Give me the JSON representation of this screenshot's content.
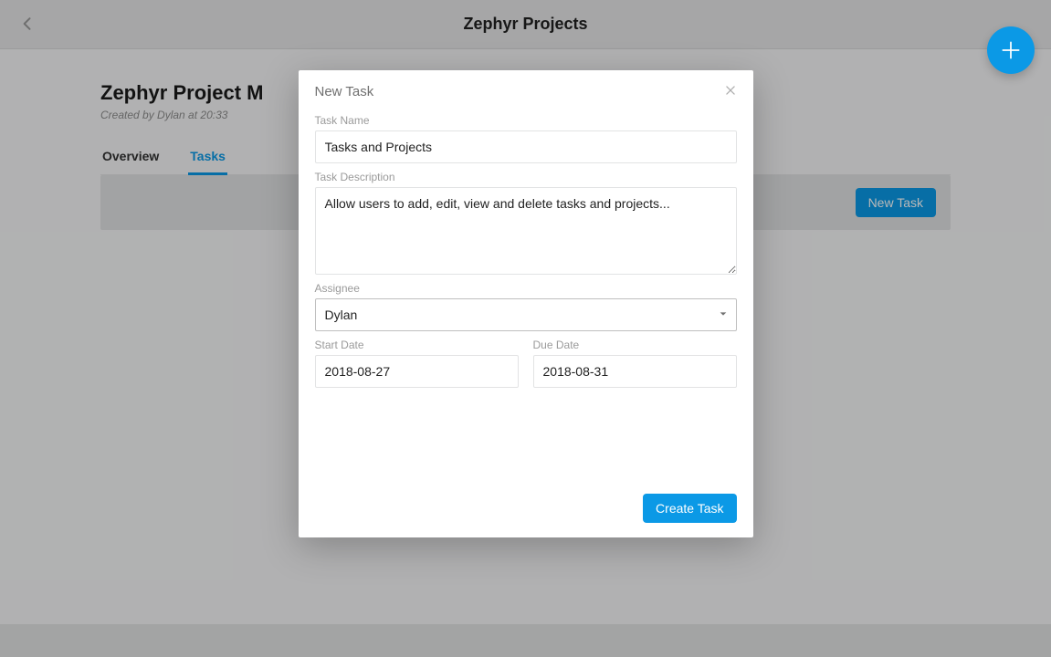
{
  "header": {
    "title": "Zephyr Projects"
  },
  "project": {
    "title": "Zephyr Project M",
    "meta": "Created by Dylan at 20:33"
  },
  "tabs": [
    {
      "label": "Overview",
      "active": false
    },
    {
      "label": "Tasks",
      "active": true
    }
  ],
  "buttons": {
    "new_task": "New Task",
    "create_task": "Create Task"
  },
  "modal": {
    "title": "New Task",
    "fields": {
      "task_name": {
        "label": "Task Name",
        "value": "Tasks and Projects"
      },
      "task_description": {
        "label": "Task Description",
        "value": "Allow users to add, edit, view and delete tasks and projects..."
      },
      "assignee": {
        "label": "Assignee",
        "value": "Dylan"
      },
      "start_date": {
        "label": "Start Date",
        "value": "2018-08-27"
      },
      "due_date": {
        "label": "Due Date",
        "value": "2018-08-31"
      }
    }
  }
}
